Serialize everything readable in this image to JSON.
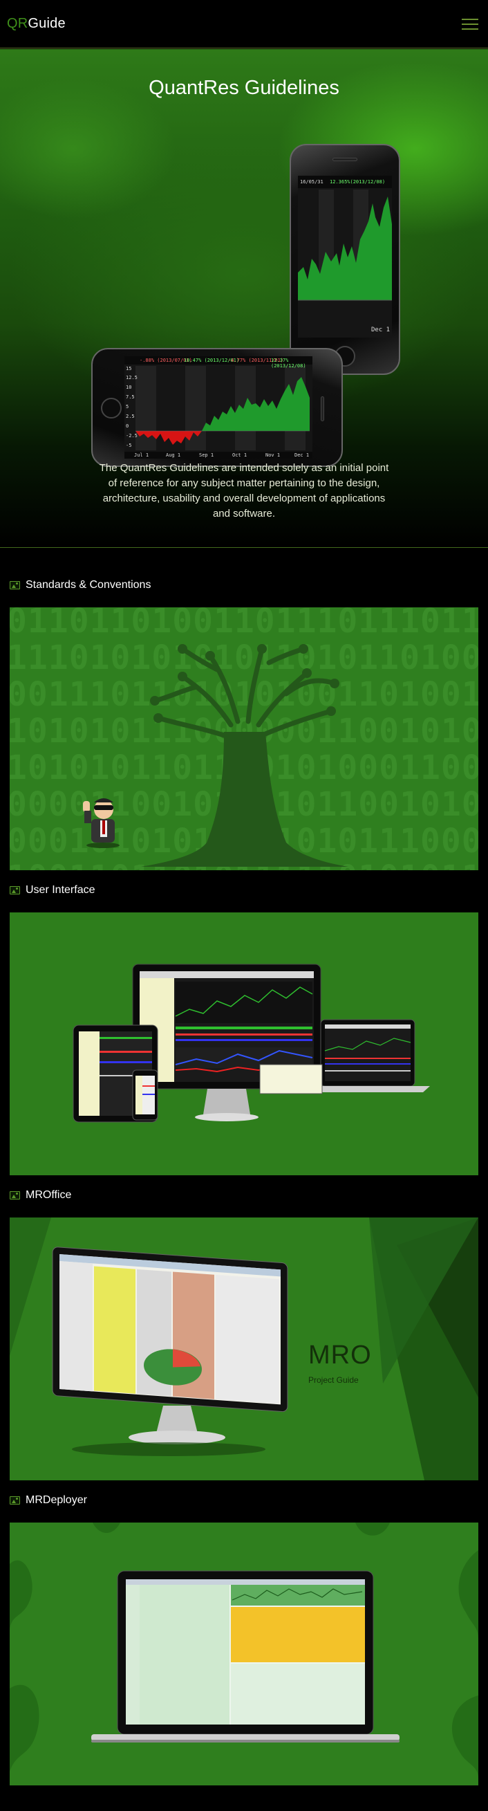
{
  "nav": {
    "logo_prefix": "QR",
    "logo_suffix": "Guide",
    "menu_icon": "hamburger-menu-icon"
  },
  "hero": {
    "title": "QuantRes Guidelines",
    "description": "The QuantRes Guidelines are intended solely as an initial point of reference for any subject matter pertaining to the design, architecture, usability and overall development of applications and software.",
    "phone_vertical": {
      "ticker": "16/05/31",
      "value": "12.365%(2013/12/08)",
      "date_label": "Dec 1"
    },
    "phone_horizontal": {
      "legend": [
        "-.88% (2013/07/01)",
        "10.47% (2013/12/01)",
        "-4.77% (2013/11/01)",
        "12.37% (2013/12/08)"
      ],
      "y_ticks": [
        "15",
        "12.5",
        "10",
        "7.5",
        "5",
        "2.5",
        "0",
        "-2.5",
        "-5"
      ],
      "x_ticks": [
        "Jul 1",
        "Aug 1",
        "Sep 1",
        "Oct 1",
        "Nov 1",
        "Dec 1"
      ]
    }
  },
  "sections": [
    {
      "label": "Standards & Conventions",
      "icon": "image-icon",
      "binary_text": "0110110100110111011101101\n1110101010101101011010001\n0011101101010100110100110\n1010101110000001100101000011\n1010101101110101000110000111\n0000110010101101100101010001\n0001010101010101011100011010\n1001101101011111010101110111\n1010101010001101011010010101"
    },
    {
      "label": "User Interface",
      "icon": "image-icon"
    },
    {
      "label": "MROffice",
      "icon": "image-icon",
      "title": "MRO",
      "subtitle": "Project Guide"
    },
    {
      "label": "MRDeployer",
      "icon": "image-icon"
    }
  ],
  "colors": {
    "accent": "#3f8f1a",
    "nav_border": "#5a6b28",
    "panel_green": "#2f7f1f"
  }
}
